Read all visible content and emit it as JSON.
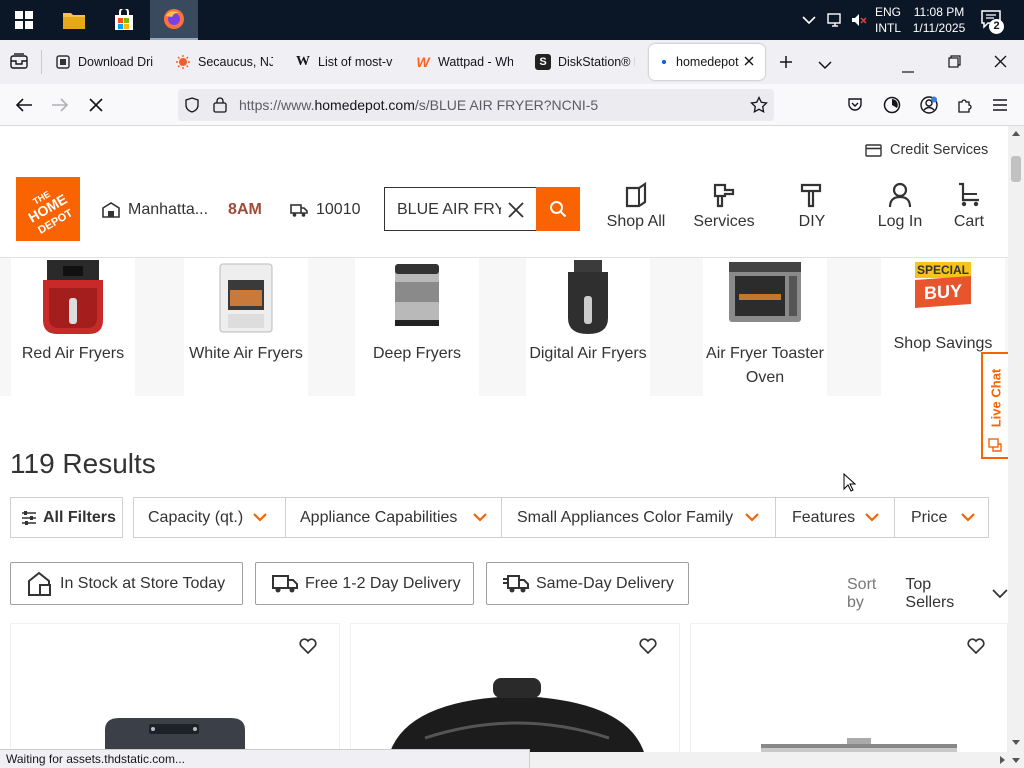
{
  "taskbar": {
    "tray_lang_1": "ENG",
    "tray_lang_2": "INTL",
    "time": "11:08 PM",
    "date": "1/11/2025",
    "notification_count": "2"
  },
  "tabs": [
    {
      "label": "Download Dri",
      "icon": "download-favicon"
    },
    {
      "label": "Secaucus, NJ D",
      "icon": "weather-favicon"
    },
    {
      "label": "List of most-vi",
      "icon": "wikipedia-favicon"
    },
    {
      "label": "Wattpad - Whe",
      "icon": "wattpad-favicon"
    },
    {
      "label": "DiskStation® D",
      "icon": "synology-favicon"
    },
    {
      "label": "homedepot",
      "icon": "loading-dot"
    }
  ],
  "browser": {
    "url_prefix": "https://www.",
    "url_domain": "homedepot.com",
    "url_path": "/s/BLUE AIR FRYER?NCNI-5"
  },
  "header": {
    "credit_services": "Credit Services",
    "logo_text": "THE HOME DEPOT",
    "store_name": "Manhatta...",
    "store_hours": "8AM",
    "zip": "10010",
    "search_value": "BLUE AIR FRY",
    "nav": [
      {
        "label": "Shop All"
      },
      {
        "label": "Services"
      },
      {
        "label": "DIY"
      },
      {
        "label": "Log In"
      },
      {
        "label": "Cart"
      }
    ]
  },
  "categories": [
    {
      "label": "Red Air Fryers"
    },
    {
      "label": "White Air Fryers"
    },
    {
      "label": "Deep Fryers"
    },
    {
      "label": "Digital Air Fryers"
    },
    {
      "label": "Air Fryer Toaster Oven"
    },
    {
      "label": "Shop Savings"
    }
  ],
  "special_buy": {
    "line1": "SPECIAL",
    "line2": "BUY"
  },
  "live_chat": "Live Chat",
  "results": {
    "count_label": "119 Results"
  },
  "filters": {
    "all_filters": "All Filters",
    "dropdowns": [
      "Capacity (qt.)",
      "Appliance Capabilities",
      "Small Appliances Color Family",
      "Features",
      "Price"
    ]
  },
  "delivery_options": [
    "In Stock at Store Today",
    "Free 1-2 Day Delivery",
    "Same-Day Delivery"
  ],
  "sort": {
    "label": "Sort by",
    "value": "Top Sellers"
  },
  "status_bar": "Waiting for assets.thdstatic.com...",
  "colors": {
    "brand_orange": "#f96302",
    "taskbar": "#0b1727"
  }
}
